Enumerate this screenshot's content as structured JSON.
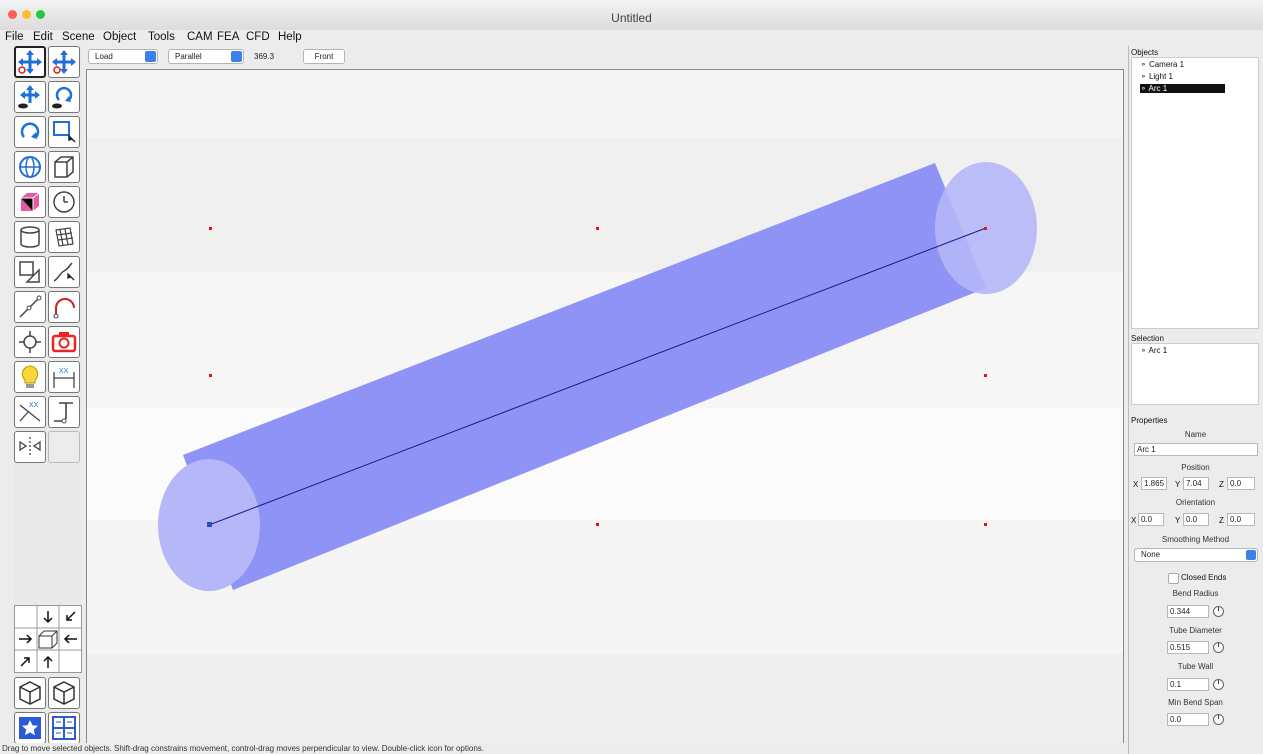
{
  "window": {
    "title": "Untitled"
  },
  "menubar": [
    "File",
    "Edit",
    "Scene",
    "Object",
    "Tools",
    "CAM",
    "FEA",
    "CFD",
    "Help"
  ],
  "view_toolbar": {
    "shading": "Load",
    "projection": "Parallel",
    "scale": "369.3",
    "view_button": "Front"
  },
  "tools": [
    "move-object",
    "move-view",
    "move-camera",
    "rotate-view",
    "rotate-object",
    "select-region",
    "sphere",
    "box",
    "cube",
    "clock",
    "cylinder",
    "grid",
    "surface",
    "curve-edit",
    "polyline",
    "arc",
    "point",
    "camera",
    "light",
    "dimension",
    "angle-dimension",
    "text",
    "split"
  ],
  "objects_panel": {
    "title": "Objects",
    "items": [
      "Camera 1",
      "Light 1",
      "Arc 1"
    ],
    "selected": "Arc 1"
  },
  "selection_panel": {
    "title": "Selection",
    "items": [
      "Arc 1"
    ]
  },
  "properties_panel": {
    "title": "Properties",
    "name_label": "Name",
    "name_value": "Arc 1",
    "position_label": "Position",
    "position": {
      "x_label": "X",
      "x": "1.865",
      "y_label": "Y",
      "y": "7.04",
      "z_label": "Z",
      "z": "0.0"
    },
    "orientation_label": "Orientation",
    "orientation": {
      "x_label": "X",
      "x": "0.0",
      "y_label": "Y",
      "y": "0.0",
      "z_label": "Z",
      "z": "0.0"
    },
    "smoothing_label": "Smoothing Method",
    "smoothing_value": "None",
    "closed_ends_label": "Closed Ends",
    "closed_ends": false,
    "bend_radius_label": "Bend Radius",
    "bend_radius": "0.344",
    "tube_diameter_label": "Tube Diameter",
    "tube_diameter": "0.515",
    "tube_wall_label": "Tube Wall",
    "tube_wall": "0.1",
    "min_bend_span_label": "Min Bend Span",
    "min_bend_span": "0.0"
  },
  "statusbar": {
    "text": "Drag to move selected objects.  Shift-drag constrains movement, control-drag moves perpendicular to view.  Double-click icon for options."
  },
  "colors": {
    "tube": "#8f93f5",
    "tube_end": "#b5b7f8",
    "centerline": "#1a1a8c",
    "control_point": "#e0141e"
  }
}
